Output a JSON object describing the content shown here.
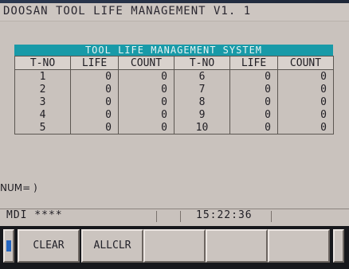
{
  "window": {
    "title": "DOOSAN TOOL LIFE MANAGEMENT V1. 1"
  },
  "panel": {
    "header": "TOOL LIFE MANAGEMENT SYSTEM",
    "columns": [
      "T-NO",
      "LIFE",
      "COUNT",
      "T-NO",
      "LIFE",
      "COUNT"
    ],
    "rows": [
      {
        "left": {
          "tno": "1",
          "life": "0",
          "count": "0"
        },
        "right": {
          "tno": "6",
          "life": "0",
          "count": "0"
        }
      },
      {
        "left": {
          "tno": "2",
          "life": "0",
          "count": "0"
        },
        "right": {
          "tno": "7",
          "life": "0",
          "count": "0"
        }
      },
      {
        "left": {
          "tno": "3",
          "life": "0",
          "count": "0"
        },
        "right": {
          "tno": "8",
          "life": "0",
          "count": "0"
        }
      },
      {
        "left": {
          "tno": "4",
          "life": "0",
          "count": "0"
        },
        "right": {
          "tno": "9",
          "life": "0",
          "count": "0"
        }
      },
      {
        "left": {
          "tno": "5",
          "life": "0",
          "count": "0"
        },
        "right": {
          "tno": "10",
          "life": "0",
          "count": "0"
        }
      }
    ]
  },
  "input": {
    "prompt": "NUM= )"
  },
  "status": {
    "mode": "MDI ****",
    "time": "15:22:36"
  },
  "softkeys": {
    "keys": [
      {
        "label": "CLEAR"
      },
      {
        "label": "ALLCLR"
      },
      {
        "label": ""
      },
      {
        "label": ""
      },
      {
        "label": ""
      }
    ]
  },
  "colors": {
    "background": "#c9c2bd",
    "header_teal": "#189aa8",
    "softkey_bar": "#17181c"
  }
}
